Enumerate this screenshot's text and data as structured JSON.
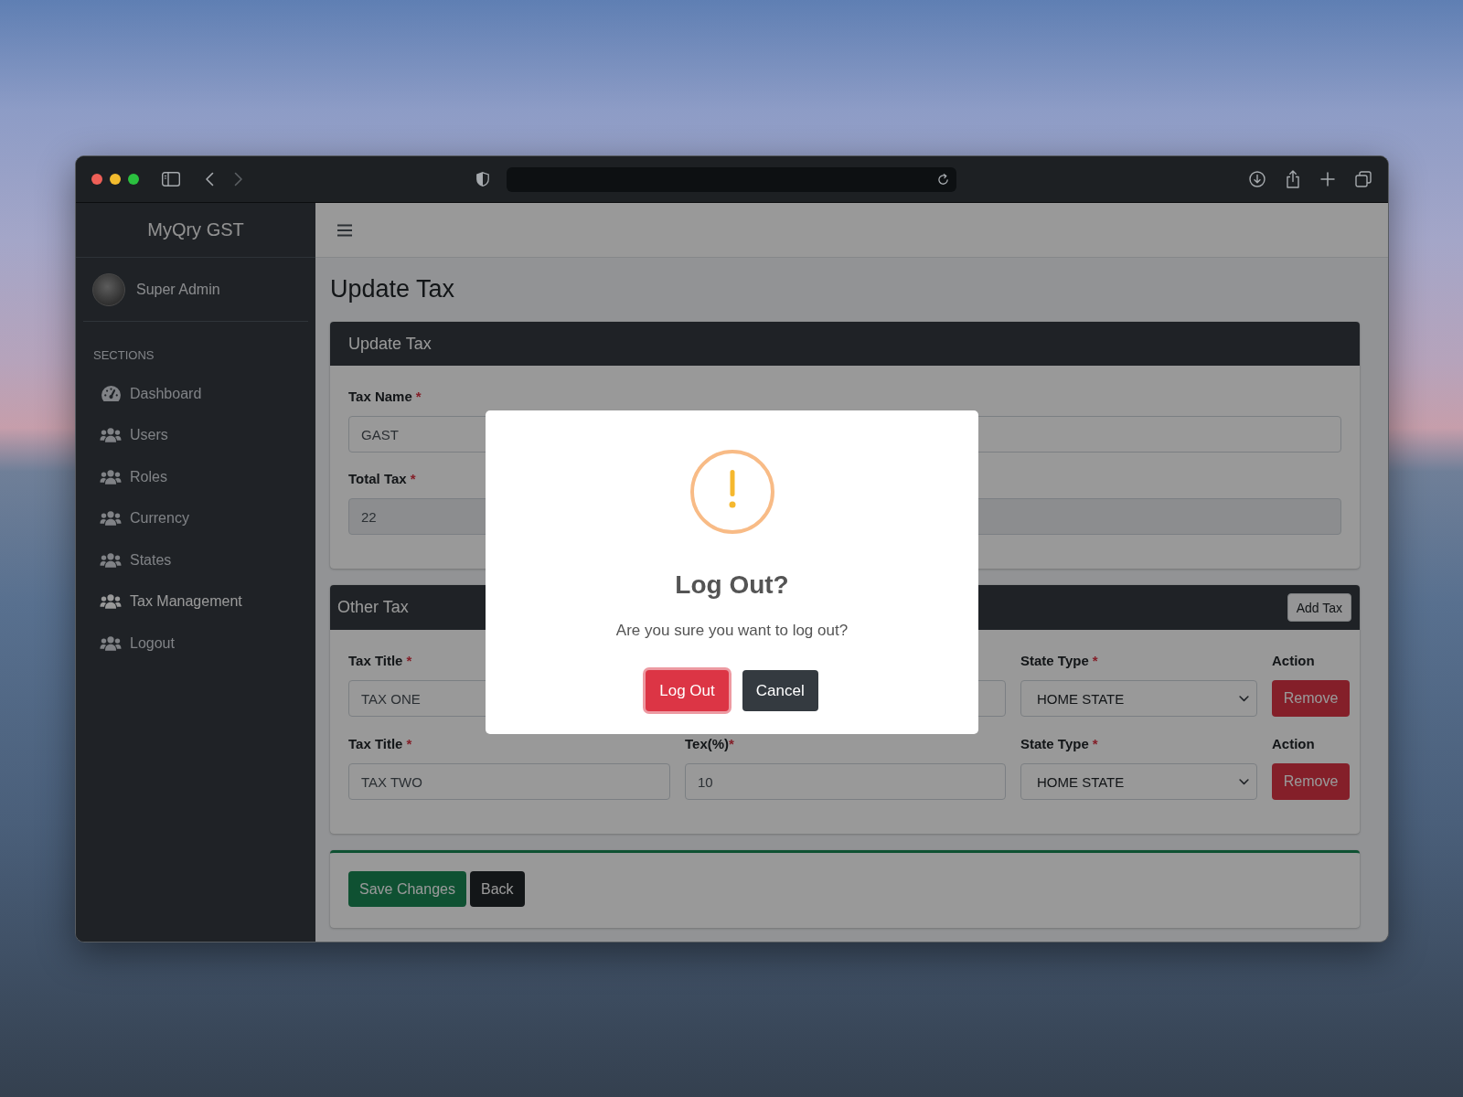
{
  "sidebar": {
    "brand": "MyQry GST",
    "user": "Super Admin",
    "section_title": "SECTIONS",
    "items": [
      {
        "label": "Dashboard",
        "selected": false
      },
      {
        "label": "Users",
        "selected": false
      },
      {
        "label": "Roles",
        "selected": false
      },
      {
        "label": "Currency",
        "selected": false
      },
      {
        "label": "States",
        "selected": false
      },
      {
        "label": "Tax Management",
        "selected": true
      },
      {
        "label": "Logout",
        "selected": false
      }
    ]
  },
  "page": {
    "title": "Update Tax"
  },
  "tax_card": {
    "header": "Update Tax",
    "fields": [
      {
        "label": "Tax Name",
        "required_mark": "*",
        "value": "GAST",
        "disabled": false
      },
      {
        "label": "Total Tax",
        "required_mark": "*",
        "value": "22",
        "disabled": true
      }
    ]
  },
  "other_tax": {
    "header": "Other Tax",
    "add_button": "Add Tax",
    "rows": [
      {
        "title_label": "Tax Title",
        "title_mark": "*",
        "title": "TAX ONE",
        "state_label": "State Type",
        "state_mark": "*",
        "state": "HOME STATE",
        "action_label": "Action",
        "remove_button": "Remove"
      },
      {
        "title_label": "Tax Title",
        "title_mark": "*",
        "title": "TAX TWO",
        "rate_label": "Tex(%)",
        "rate_mark": "*",
        "rate": "10",
        "state_label": "State Type",
        "state_mark": "*",
        "state": "HOME STATE",
        "action_label": "Action",
        "remove_button": "Remove"
      }
    ]
  },
  "footer_buttons": [
    {
      "label": "Save Changes",
      "kind": "save"
    },
    {
      "label": "Back",
      "kind": "back"
    }
  ],
  "dialog": {
    "title": "Log Out?",
    "message": "Are you sure you want to log out?",
    "buttons": [
      {
        "label": "Log Out",
        "kind": "confirm",
        "focused": true
      },
      {
        "label": "Cancel",
        "kind": "cancel",
        "focused": false
      }
    ]
  }
}
